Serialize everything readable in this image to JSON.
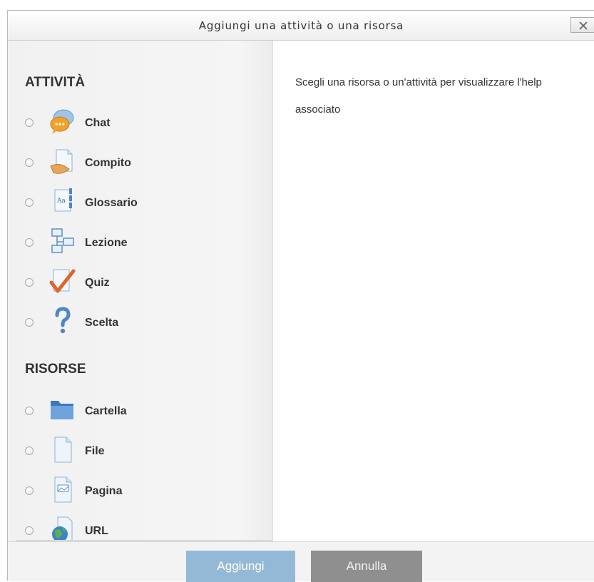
{
  "dialog": {
    "title": "Aggiungi una attività o una risorsa",
    "close_label": "X"
  },
  "activities": {
    "heading": "ATTIVITÀ",
    "items": [
      {
        "label": "Chat",
        "icon": "chat-icon"
      },
      {
        "label": "Compito",
        "icon": "assignment-icon"
      },
      {
        "label": "Glossario",
        "icon": "glossary-icon"
      },
      {
        "label": "Lezione",
        "icon": "lesson-icon"
      },
      {
        "label": "Quiz",
        "icon": "quiz-checkmark-icon"
      },
      {
        "label": "Scelta",
        "icon": "question-mark-icon"
      }
    ]
  },
  "resources": {
    "heading": "RISORSE",
    "items": [
      {
        "label": "Cartella",
        "icon": "folder-icon"
      },
      {
        "label": "File",
        "icon": "file-icon"
      },
      {
        "label": "Pagina",
        "icon": "page-icon"
      },
      {
        "label": "URL",
        "icon": "url-globe-icon"
      }
    ]
  },
  "help": {
    "text": "Scegli una risorsa o un'attività per visualizzare l'help associato"
  },
  "footer": {
    "add_label": "Aggiungi",
    "cancel_label": "Annulla"
  },
  "colors": {
    "add_button": "#94b9d7",
    "cancel_button": "#8f8f8f",
    "panel_background": "#f3f3f3"
  }
}
